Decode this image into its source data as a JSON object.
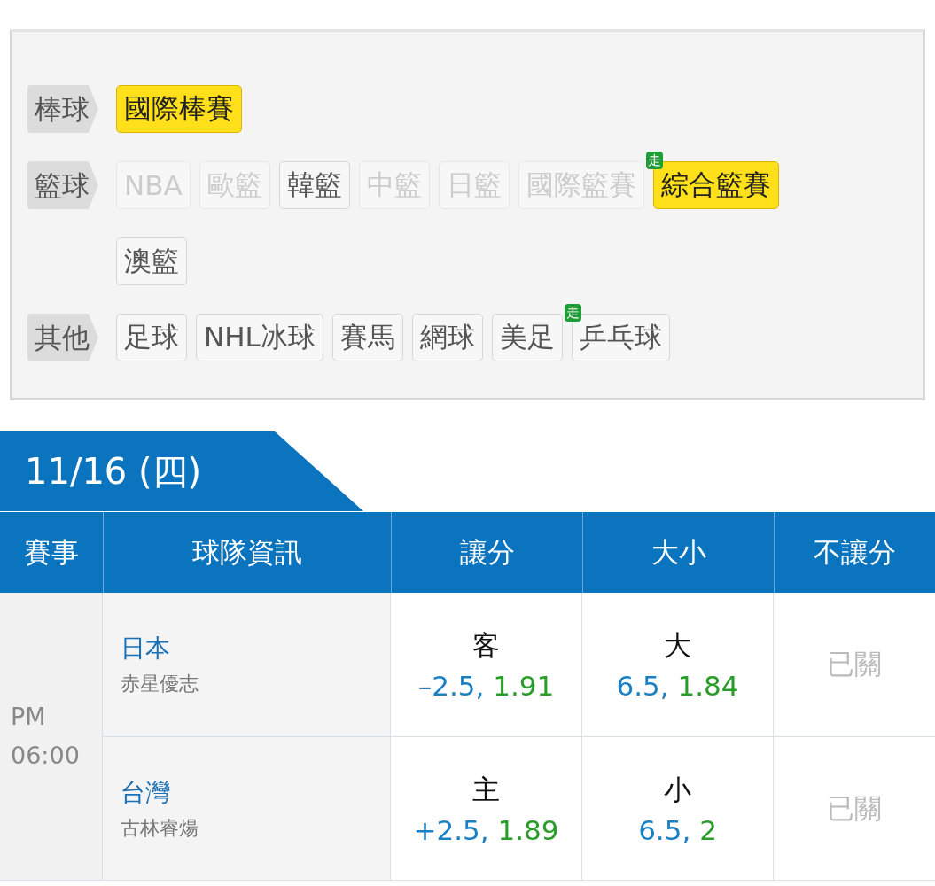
{
  "categories": [
    {
      "label": "棒球",
      "leagues": [
        {
          "name": "國際棒賽",
          "selected": true,
          "disabled": false
        }
      ]
    },
    {
      "label": "籃球",
      "leagues": [
        {
          "name": "NBA",
          "selected": false,
          "disabled": true
        },
        {
          "name": "歐籃",
          "selected": false,
          "disabled": true
        },
        {
          "name": "韓籃",
          "selected": false,
          "disabled": false
        },
        {
          "name": "中籃",
          "selected": false,
          "disabled": true
        },
        {
          "name": "日籃",
          "selected": false,
          "disabled": true
        },
        {
          "name": "國際籃賽",
          "selected": false,
          "disabled": true
        },
        {
          "name": "綜合籃賽",
          "selected": true,
          "disabled": false,
          "badge": "走"
        },
        {
          "name": "澳籃",
          "selected": false,
          "disabled": false
        }
      ]
    },
    {
      "label": "其他",
      "leagues": [
        {
          "name": "足球",
          "selected": false,
          "disabled": false
        },
        {
          "name": "NHL冰球",
          "selected": false,
          "disabled": false
        },
        {
          "name": "賽馬",
          "selected": false,
          "disabled": false
        },
        {
          "name": "網球",
          "selected": false,
          "disabled": false
        },
        {
          "name": "美足",
          "selected": false,
          "disabled": false
        },
        {
          "name": "乒乓球",
          "selected": false,
          "disabled": false,
          "badge": "走"
        }
      ]
    }
  ],
  "date_tab": "11/16 (四)",
  "table": {
    "columns": [
      "賽事",
      "球隊資訊",
      "讓分",
      "大小",
      "不讓分"
    ],
    "match": {
      "time_period": "PM",
      "time": "06:00",
      "teams": [
        {
          "team": "日本",
          "pitcher": "赤星優志",
          "spread": {
            "side": "客",
            "line": "–2.5,",
            "odds": "1.91"
          },
          "total": {
            "side": "大",
            "line": "6.5,",
            "odds": "1.84"
          },
          "moneyline": "已關"
        },
        {
          "team": "台灣",
          "pitcher": "古林睿煬",
          "spread": {
            "side": "主",
            "line": "+2.5,",
            "odds": "1.89"
          },
          "total": {
            "side": "小",
            "line": "6.5,",
            "odds": "2"
          },
          "moneyline": "已關"
        }
      ]
    }
  }
}
